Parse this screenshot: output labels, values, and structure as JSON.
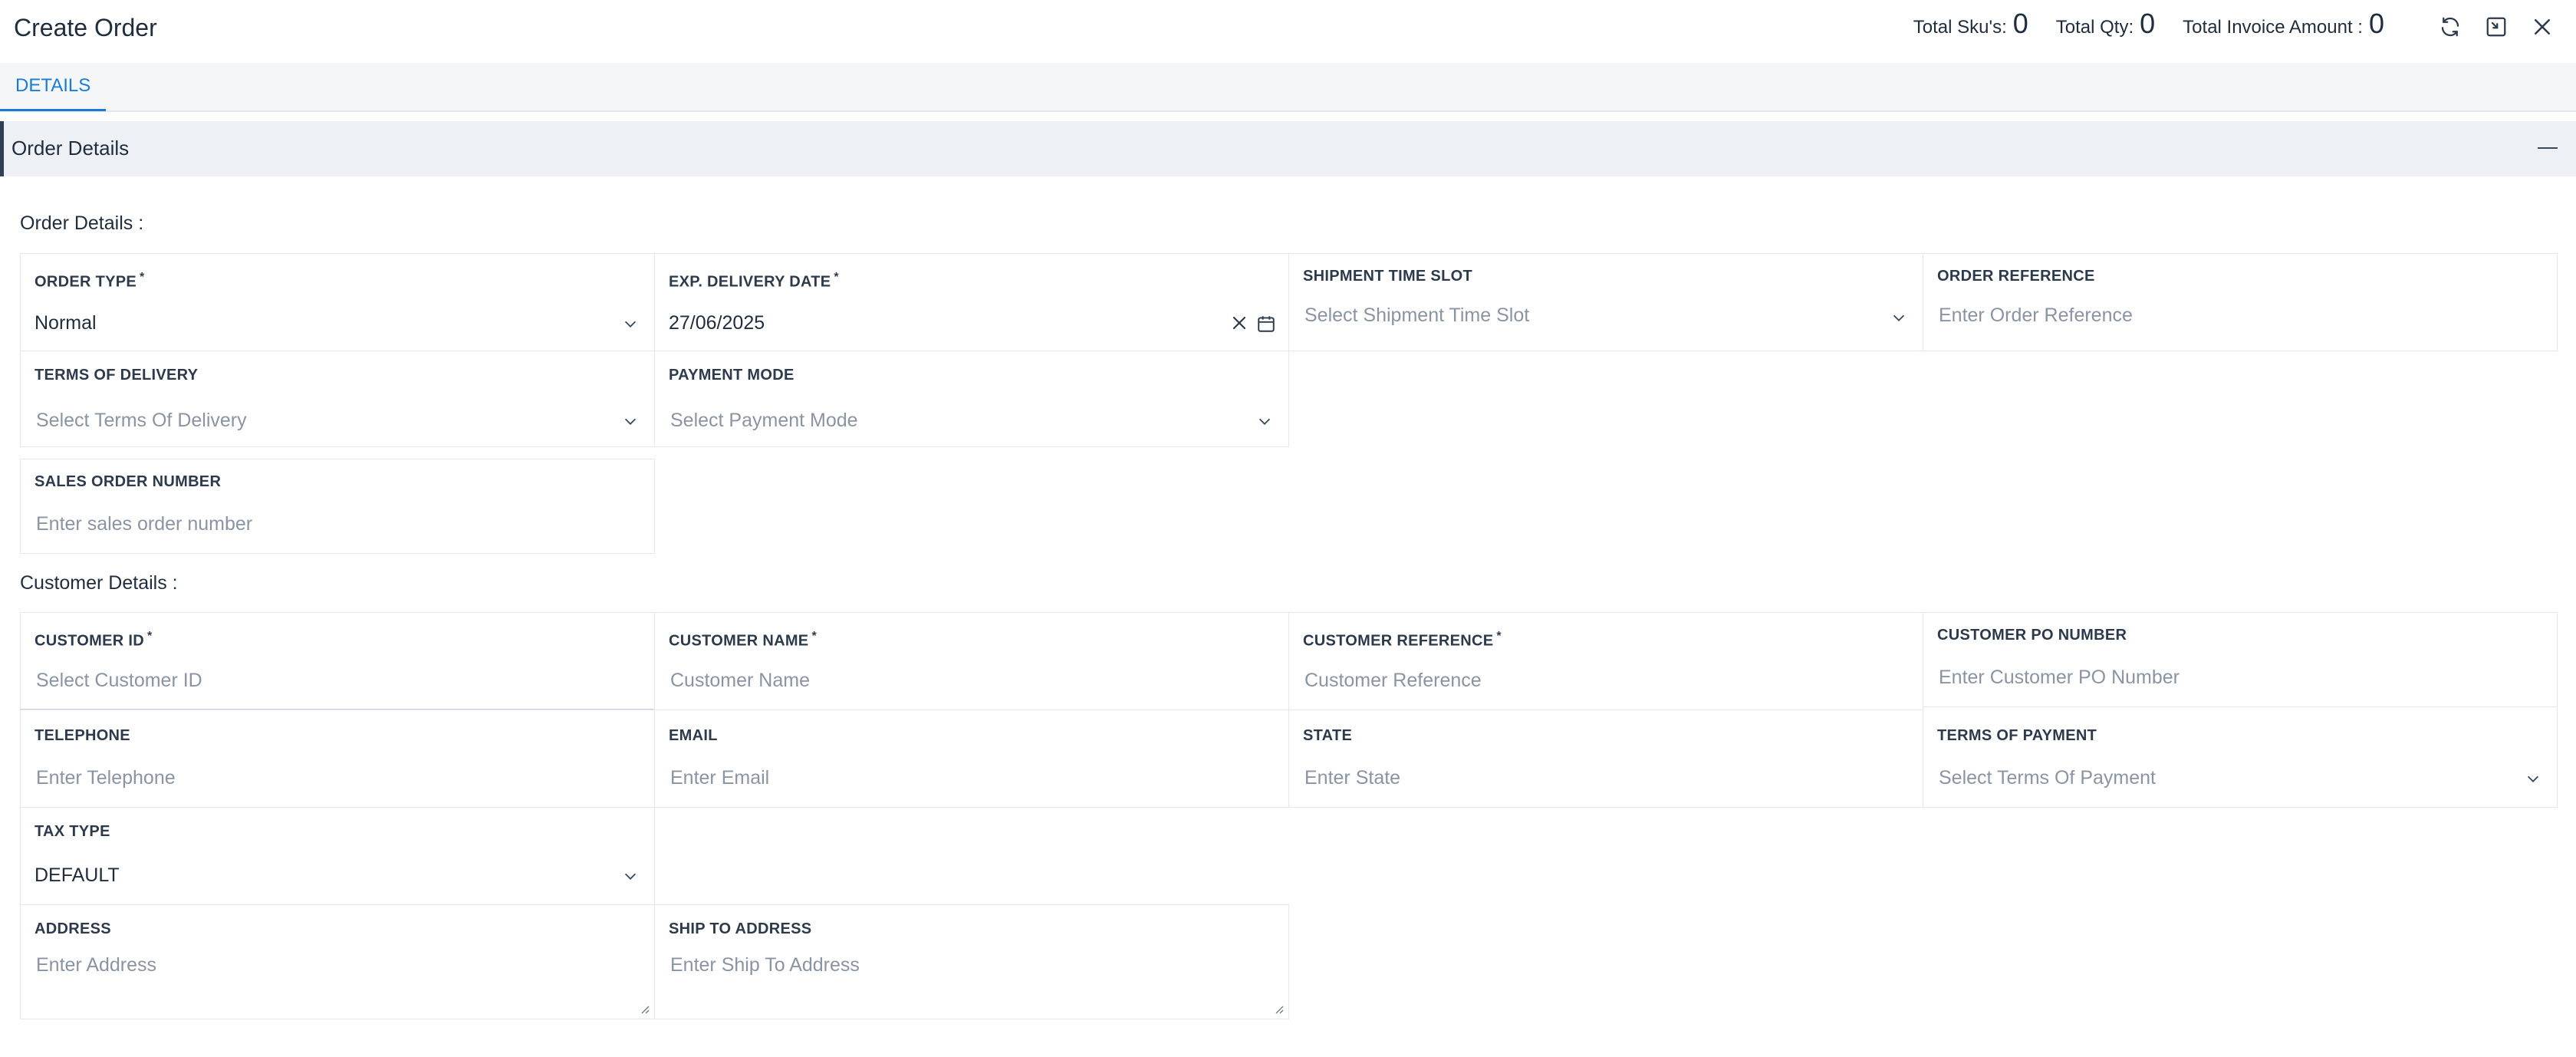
{
  "header": {
    "title": "Create Order",
    "totals": [
      {
        "label": "Total Sku's:",
        "value": "0"
      },
      {
        "label": "Total Qty:",
        "value": "0"
      },
      {
        "label": "Total Invoice Amount :",
        "value": "0"
      }
    ],
    "icons": [
      "refresh-icon",
      "collapse-window-icon",
      "close-icon"
    ]
  },
  "tabs": [
    {
      "label": "DETAILS",
      "active": true
    }
  ],
  "section": {
    "title": "Order Details"
  },
  "order_details": {
    "title": "Order Details :",
    "order_type": {
      "label": "ORDER TYPE",
      "value": "Normal"
    },
    "delivery_date": {
      "label": "EXP. DELIVERY DATE",
      "value": "27/06/2025"
    },
    "shipment_slot": {
      "label": "SHIPMENT TIME SLOT",
      "placeholder": "Select Shipment Time Slot"
    },
    "order_reference": {
      "label": "ORDER REFERENCE",
      "placeholder": "Enter Order Reference"
    },
    "terms_delivery": {
      "label": "TERMS OF DELIVERY",
      "placeholder": "Select Terms Of Delivery"
    },
    "payment_mode": {
      "label": "PAYMENT MODE",
      "placeholder": "Select Payment Mode"
    },
    "sales_order": {
      "label": "SALES ORDER NUMBER",
      "placeholder": "Enter sales order number"
    }
  },
  "customer_details": {
    "title": "Customer Details :",
    "customer_id": {
      "label": "CUSTOMER ID",
      "placeholder": "Select Customer ID"
    },
    "customer_name": {
      "label": "CUSTOMER NAME",
      "placeholder": "Customer Name"
    },
    "customer_reference": {
      "label": "CUSTOMER REFERENCE",
      "placeholder": "Customer Reference"
    },
    "customer_po": {
      "label": "CUSTOMER PO NUMBER",
      "placeholder": "Enter Customer PO Number"
    },
    "telephone": {
      "label": "TELEPHONE",
      "placeholder": "Enter Telephone"
    },
    "email": {
      "label": "EMAIL",
      "placeholder": "Enter Email"
    },
    "state": {
      "label": "STATE",
      "placeholder": "Enter State"
    },
    "terms_payment": {
      "label": "TERMS OF PAYMENT",
      "placeholder": "Select Terms Of Payment"
    },
    "tax_type": {
      "label": "TAX TYPE",
      "value": "DEFAULT"
    },
    "address": {
      "label": "ADDRESS",
      "placeholder": "Enter Address"
    },
    "ship_to": {
      "label": "SHIP TO ADDRESS",
      "placeholder": "Enter Ship To Address"
    }
  },
  "colors": {
    "accent": "#1a7bd6",
    "section_bg": "#edf0f4",
    "section_border": "#2f3f54"
  }
}
